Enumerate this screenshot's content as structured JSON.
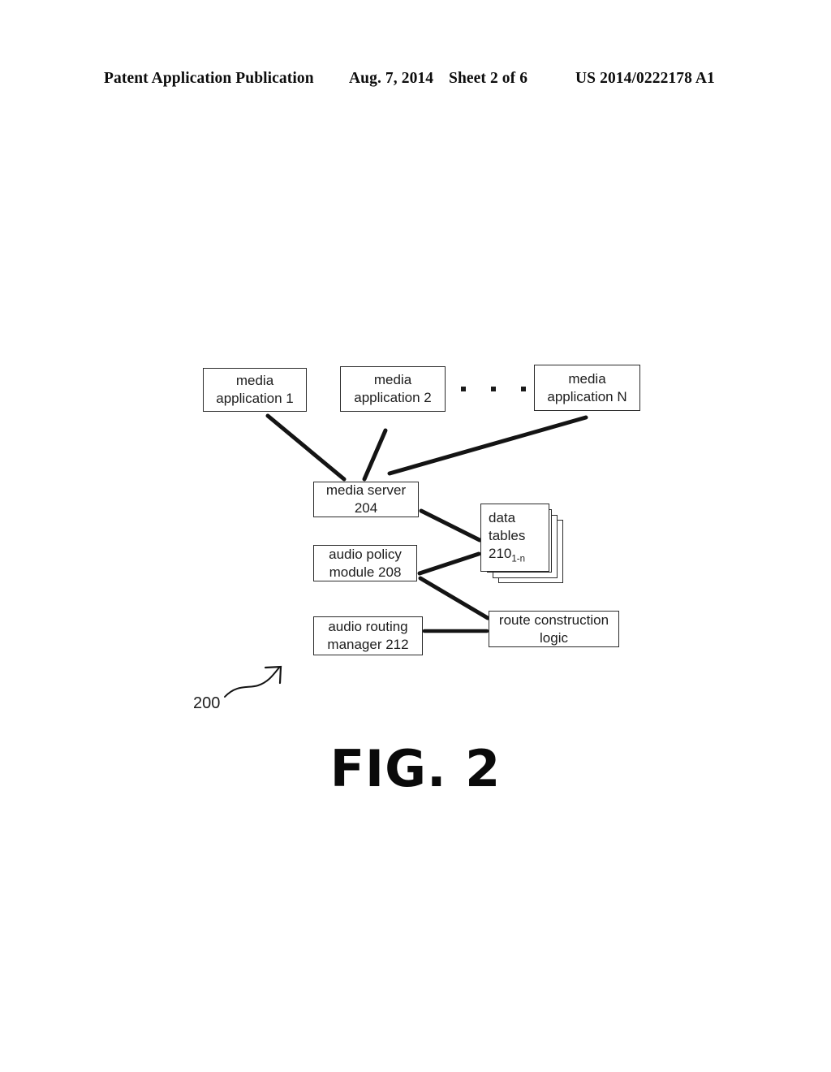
{
  "header": {
    "publication": "Patent Application Publication",
    "date": "Aug. 7, 2014",
    "sheet": "Sheet 2 of 6",
    "patent_number": "US 2014/0222178 A1"
  },
  "figure": {
    "label": "FIG. 2",
    "reference_numeral": "200"
  },
  "diagram": {
    "nodes": {
      "media_application_1": {
        "line1": "media",
        "line2": "application 1"
      },
      "media_application_2": {
        "line1": "media",
        "line2": "application 2"
      },
      "media_application_n": {
        "line1": "media",
        "line2": "application N"
      },
      "media_server": {
        "line1": "media server",
        "line2": "204"
      },
      "audio_policy_module": {
        "line1": "audio policy",
        "line2": "module 208"
      },
      "audio_routing_manager": {
        "line1": "audio routing",
        "line2": "manager 212"
      },
      "route_construction_logic": {
        "line1": "route construction",
        "line2": "logic"
      },
      "data_tables": {
        "line1": "data",
        "line2": "tables",
        "line3": "210",
        "subscript": "1-n"
      }
    },
    "ellipsis": "• • •",
    "connections": [
      {
        "from": "media_application_1",
        "to": "media_server"
      },
      {
        "from": "media_application_2",
        "to": "media_server"
      },
      {
        "from": "media_application_n",
        "to": "media_server"
      },
      {
        "from": "media_server",
        "to": "data_tables"
      },
      {
        "from": "audio_policy_module",
        "to": "data_tables"
      },
      {
        "from": "audio_policy_module",
        "to": "route_construction_logic"
      },
      {
        "from": "audio_routing_manager",
        "to": "route_construction_logic"
      }
    ]
  },
  "colors": {
    "ink": "#1d1d1d",
    "line": "#141414",
    "background": "#ffffff"
  }
}
